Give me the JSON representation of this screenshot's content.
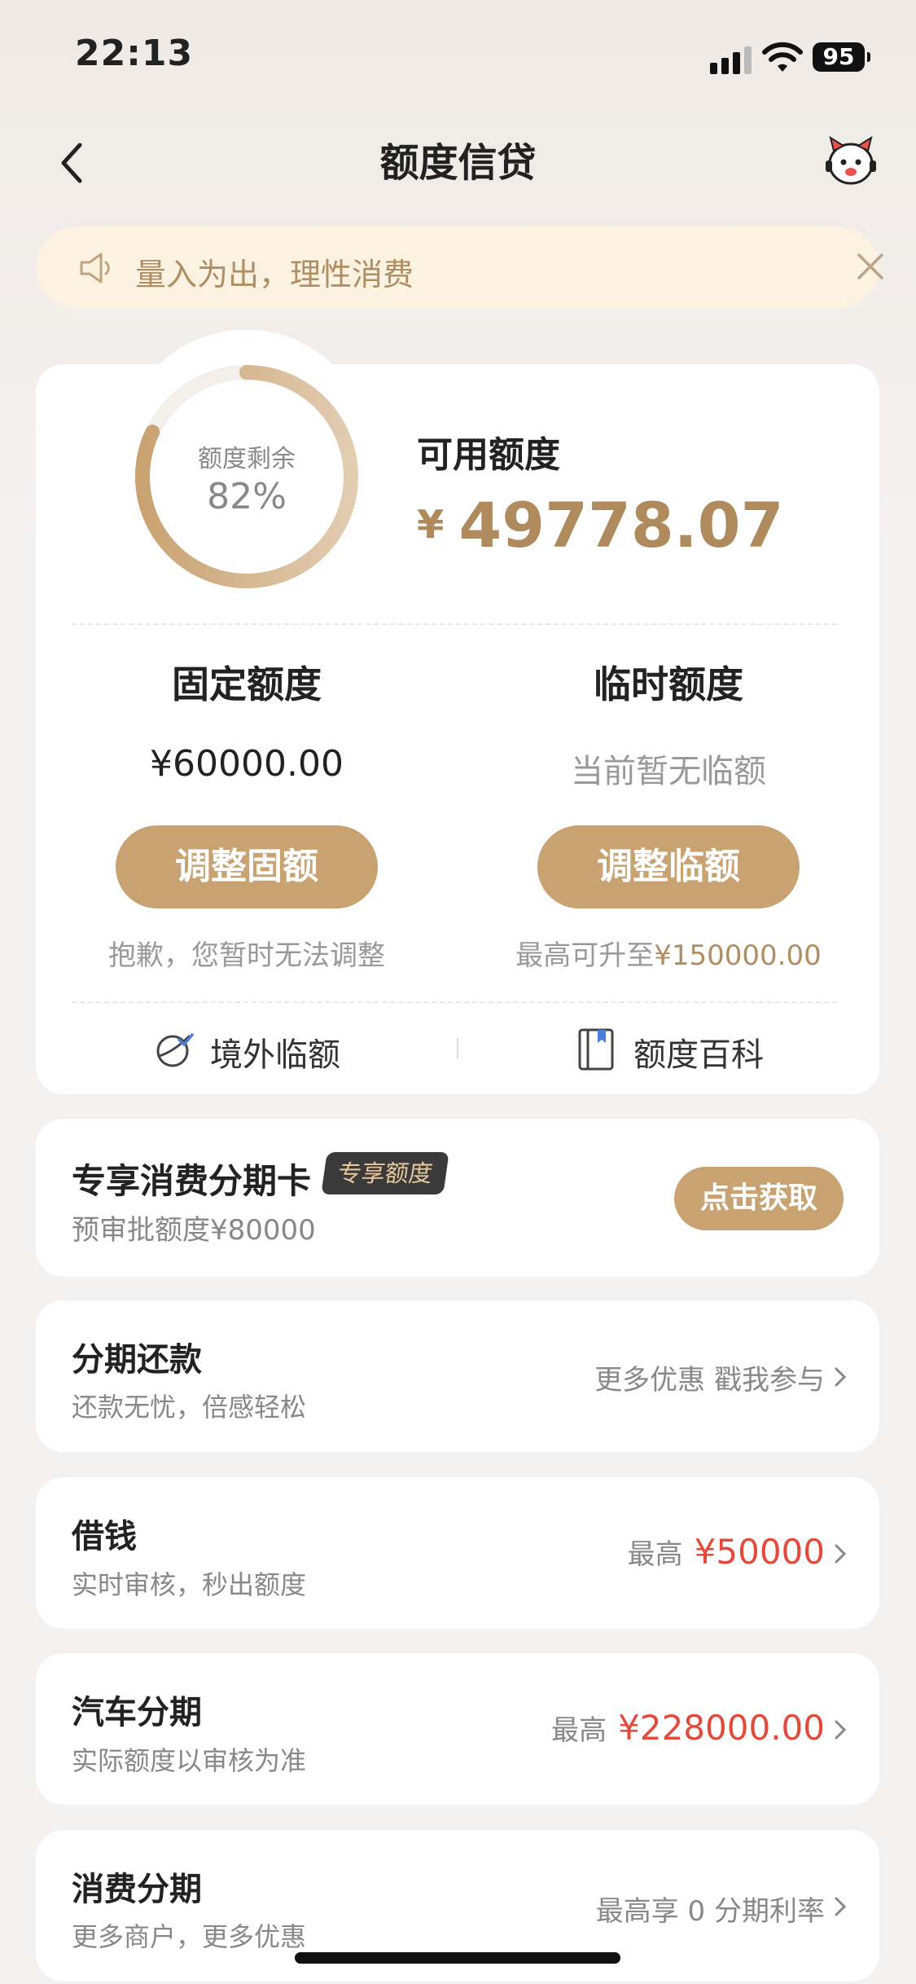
{
  "status_bar": {
    "time": "22:13",
    "battery": "95"
  },
  "nav": {
    "title": "额度信贷"
  },
  "notice": {
    "text": "量入为出，理性消费"
  },
  "credit": {
    "gauge_label": "额度剩余",
    "gauge_percent": "82%",
    "remaining_fraction": 0.82,
    "available_label": "可用额度",
    "currency": "¥",
    "available_value": "49778.07"
  },
  "fixed": {
    "title": "固定额度",
    "value": "¥60000.00",
    "button": "调整固额",
    "note": "抱歉，您暂时无法调整"
  },
  "temporary": {
    "title": "临时额度",
    "value": "当前暂无临额",
    "button": "调整临额",
    "note_prefix": "最高可升至",
    "note_amount": "¥150000.00"
  },
  "links": {
    "overseas": "境外临额",
    "wiki": "额度百科"
  },
  "installment_card": {
    "title": "专享消费分期卡",
    "badge": "专享额度",
    "subtitle": "预审批额度¥80000",
    "button": "点击获取"
  },
  "rows": [
    {
      "title": "分期还款",
      "subtitle": "还款无忧，倍感轻松",
      "right_text": "更多优惠 戳我参与",
      "highlight": ""
    },
    {
      "title": "借钱",
      "subtitle": "实时审核，秒出额度",
      "right_text": "最高",
      "highlight": "¥50000"
    },
    {
      "title": "汽车分期",
      "subtitle": "实际额度以审核为准",
      "right_text": "最高",
      "highlight": "¥228000.00"
    },
    {
      "title": "消费分期",
      "subtitle": "更多商户，更多优惠",
      "right_text": "最高享 0 分期利率",
      "highlight": ""
    }
  ],
  "colors": {
    "gold": "#c9a272",
    "gold_text": "#ae8a5c",
    "red": "#e24a3b",
    "notice_bg": "#fbf2e2"
  },
  "icons": [
    "chevron-left-icon",
    "mascot-icon",
    "speaker-icon",
    "close-icon",
    "globe-icon",
    "book-icon",
    "chevron-right-icon"
  ]
}
